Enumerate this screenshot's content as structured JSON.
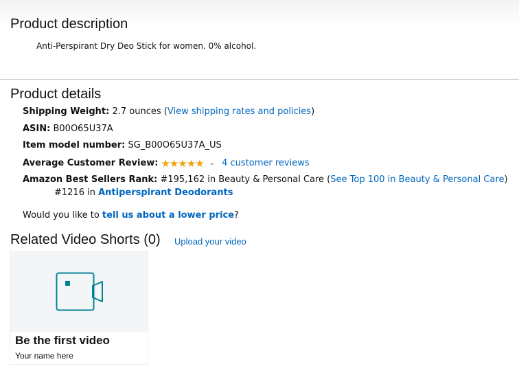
{
  "description": {
    "heading": "Product description",
    "text": "Anti-Perspirant Dry Deo Stick for women. 0% alcohol."
  },
  "details": {
    "heading": "Product details",
    "shipping": {
      "label": "Shipping Weight:",
      "value": "2.7 ounces (",
      "link": "View shipping rates and policies",
      "suffix": ")"
    },
    "asin": {
      "label": "ASIN:",
      "value": "B00O65U37A"
    },
    "model": {
      "label": "Item model number:",
      "value": "SG_B00O65U37A_US"
    },
    "review": {
      "label": "Average Customer Review:",
      "stars": "★★★★★",
      "rating": 5,
      "link": "4 customer reviews"
    },
    "rank": {
      "label": "Amazon Best Sellers Rank:",
      "value": "#195,162 in Beauty & Personal Care (",
      "link": "See Top 100 in Beauty & Personal Care",
      "suffix": ")",
      "sub_prefix": "#1216 in ",
      "sub_link": "Antiperspirant Deodorants"
    },
    "lower_price": {
      "prefix": "Would you like to ",
      "link": "tell us about a lower price",
      "suffix": "?"
    }
  },
  "videos": {
    "heading": "Related Video Shorts (0)",
    "upload_link": "Upload your video",
    "card_title": "Be the first video",
    "card_subtitle": "Your name here",
    "icon": "video-camera-icon",
    "accent": "#008296"
  },
  "colors": {
    "link": "#0066c0",
    "star": "#f0a30a"
  }
}
